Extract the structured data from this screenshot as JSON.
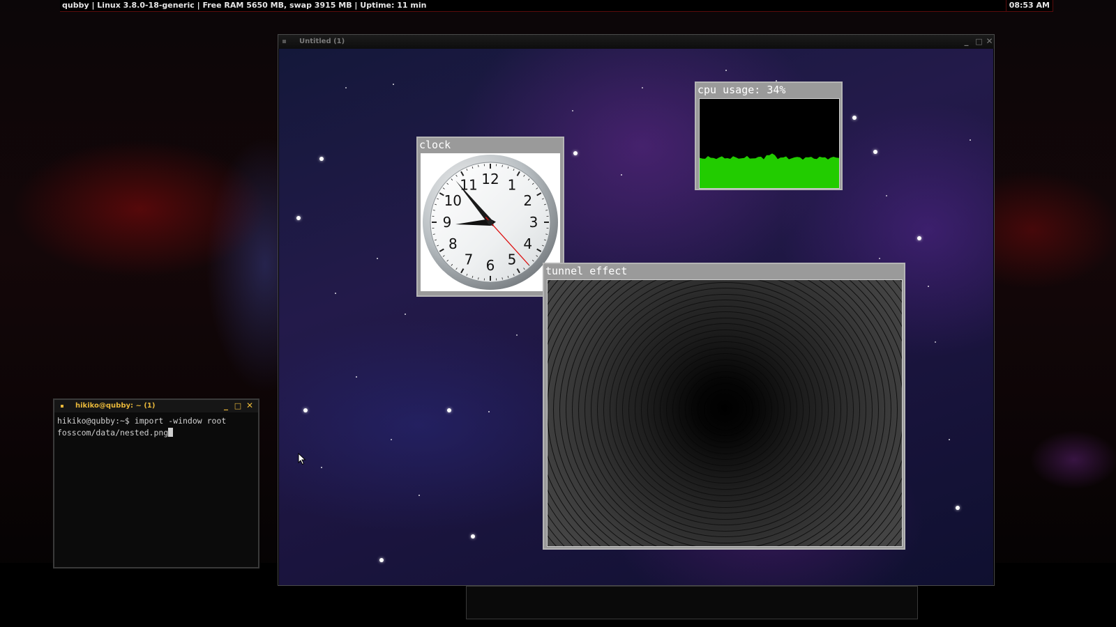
{
  "statusbar": {
    "info": "qubby | Linux 3.8.0-18-generic | Free RAM 5650 MB, swap 3915 MB | Uptime: 11 min",
    "clock": "08:53 AM"
  },
  "nested_window": {
    "title": "Untitled (1)",
    "controls": {
      "minimize": "_",
      "maximize": "□",
      "close": "✕"
    }
  },
  "clock_widget": {
    "title": "clock",
    "numerals": [
      "12",
      "1",
      "2",
      "3",
      "4",
      "5",
      "6",
      "7",
      "8",
      "9",
      "10",
      "11"
    ],
    "time": {
      "hour": 8,
      "minute": 53,
      "second": 23
    }
  },
  "cpu_widget": {
    "title": "cpu usage: 34%",
    "usage_percent": 34,
    "graph_color": "#22cc00"
  },
  "tunnel_widget": {
    "title": "tunnel effect"
  },
  "terminal": {
    "title": "hikiko@qubby: ~ (1)",
    "controls": {
      "minimize": "_",
      "maximize": "□",
      "close": "✕"
    },
    "line1": "hikiko@qubby:~$ import -window root",
    "line2": "fosscom/data/nested.png"
  },
  "icons": {
    "pointer": "mouse-pointer-icon",
    "window_menu": "window-menu-icon"
  }
}
